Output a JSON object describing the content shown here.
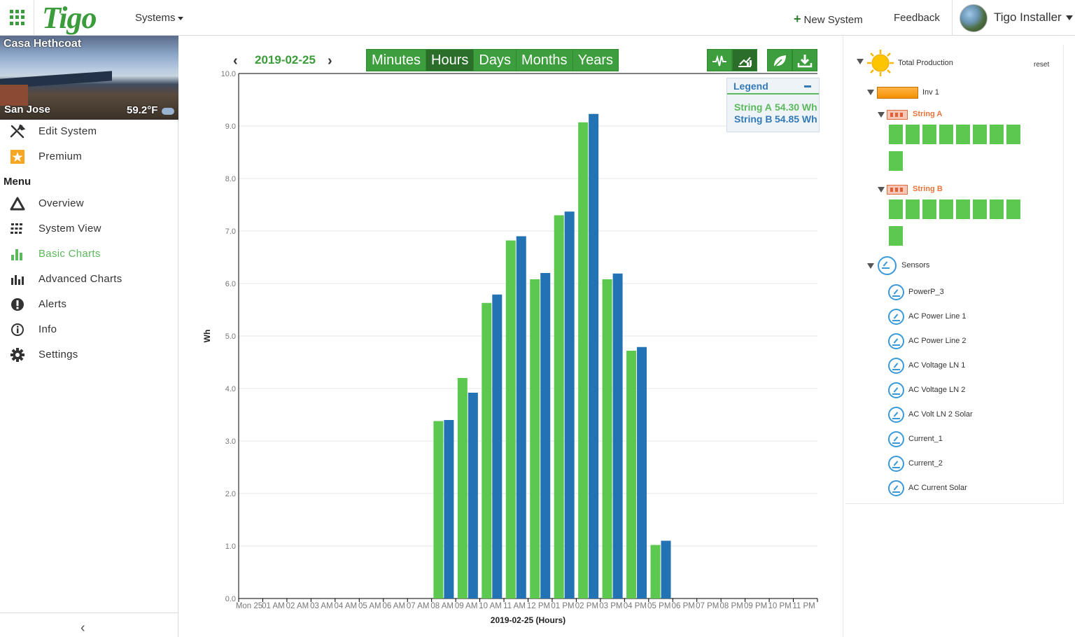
{
  "topbar": {
    "logo": "Tigo",
    "logo_mark": "®",
    "systems_label": "Systems",
    "new_system_label": "New System",
    "feedback_label": "Feedback",
    "user_name": "Tigo Installer"
  },
  "site": {
    "name": "Casa Hethcoat",
    "city": "San Jose",
    "temperature": "59.2°F"
  },
  "sidebar": {
    "top_items": [
      {
        "label": "Edit System",
        "icon": "tools-icon"
      },
      {
        "label": "Premium",
        "icon": "star-icon"
      }
    ],
    "menu_header": "Menu",
    "menu_items": [
      {
        "label": "Overview",
        "icon": "overview-icon"
      },
      {
        "label": "System View",
        "icon": "grid-icon"
      },
      {
        "label": "Basic Charts",
        "icon": "bar-chart-icon",
        "active": true
      },
      {
        "label": "Advanced Charts",
        "icon": "advanced-chart-icon"
      },
      {
        "label": "Alerts",
        "icon": "alert-icon"
      },
      {
        "label": "Info",
        "icon": "info-icon"
      },
      {
        "label": "Settings",
        "icon": "gear-icon"
      }
    ]
  },
  "date_nav": {
    "date": "2019-02-25"
  },
  "period_tabs": [
    {
      "label": "Minutes",
      "active": false
    },
    {
      "label": "Hours",
      "active": true
    },
    {
      "label": "Days",
      "active": false
    },
    {
      "label": "Months",
      "active": false
    },
    {
      "label": "Years",
      "active": false
    }
  ],
  "toolbar": {
    "buttons": [
      {
        "icon": "pulse-icon",
        "active": false
      },
      {
        "icon": "stacked-chart-icon",
        "active": true
      },
      {
        "icon": "leaf-icon",
        "active": false
      },
      {
        "icon": "download-icon",
        "active": false
      }
    ]
  },
  "legend": {
    "title": "Legend",
    "entries": [
      {
        "name": "String A",
        "value": "54.30 Wh",
        "color": "#5cb85c"
      },
      {
        "name": "String B",
        "value": "54.85 Wh",
        "color": "#337ab7"
      }
    ]
  },
  "chart_data": {
    "type": "bar",
    "ylabel": "Wh",
    "xlabel": "2019-02-25 (Hours)",
    "ylim": [
      0,
      10
    ],
    "yticks": [
      "0.0",
      "1.0",
      "2.0",
      "3.0",
      "4.0",
      "5.0",
      "6.0",
      "7.0",
      "8.0",
      "9.0",
      "10.0"
    ],
    "categories": [
      "Mon 25",
      "01 AM",
      "02 AM",
      "03 AM",
      "04 AM",
      "05 AM",
      "06 AM",
      "07 AM",
      "08 AM",
      "09 AM",
      "10 AM",
      "11 AM",
      "12 PM",
      "01 PM",
      "02 PM",
      "03 PM",
      "04 PM",
      "05 PM",
      "06 PM",
      "07 PM",
      "08 PM",
      "09 PM",
      "10 PM",
      "11 PM"
    ],
    "series": [
      {
        "name": "String A",
        "color": "#5cc84f",
        "values": [
          0,
          0,
          0,
          0,
          0,
          0,
          0,
          0,
          3.38,
          4.2,
          5.63,
          6.82,
          6.08,
          7.3,
          9.07,
          6.08,
          4.72,
          1.02,
          0,
          0,
          0,
          0,
          0,
          0
        ]
      },
      {
        "name": "String B",
        "color": "#2272b4",
        "values": [
          0,
          0,
          0,
          0,
          0,
          0,
          0,
          0,
          3.4,
          3.92,
          5.79,
          6.9,
          6.2,
          7.37,
          9.23,
          6.19,
          4.79,
          1.1,
          0,
          0,
          0,
          0,
          0,
          0
        ]
      }
    ],
    "grid": true,
    "legend": "top-right"
  },
  "tree": {
    "reset_label": "reset",
    "root": "Total Production",
    "inverter": "Inv 1",
    "strings": [
      {
        "name": "String A",
        "panels": 9
      },
      {
        "name": "String B",
        "panels": 9
      }
    ],
    "sensors_label": "Sensors",
    "sensors": [
      "PowerP_3",
      "AC Power Line 1",
      "AC Power Line 2",
      "AC Voltage LN 1",
      "AC Voltage LN 2",
      "AC Volt LN 2 Solar",
      "Current_1",
      "Current_2",
      "AC Current Solar"
    ]
  }
}
